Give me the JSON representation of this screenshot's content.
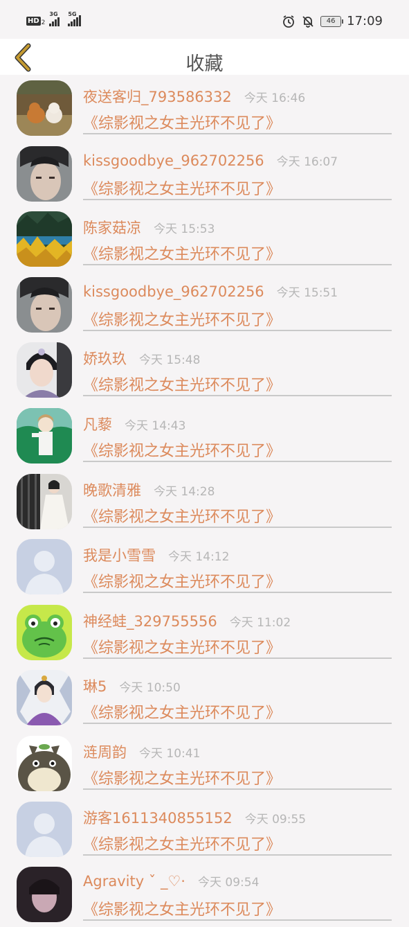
{
  "status_bar": {
    "hd": "HD",
    "sim2": "2",
    "net1": "3G",
    "net2": "5G",
    "battery": "46",
    "time": "17:09"
  },
  "header": {
    "title": "收藏",
    "back_icon": "chevron-left-icon"
  },
  "colors": {
    "accent": "#dc8a5c",
    "time": "#b6b6b6",
    "back": "#c59b32"
  },
  "items": [
    {
      "name": "夜送客归_793586332",
      "time": "今天 16:46",
      "book": "《综影视之女主光环不见了》",
      "avatar": "dogs"
    },
    {
      "name": "kissgoodbye_962702256",
      "time": "今天 16:07",
      "book": "《综影视之女主光环不见了》",
      "avatar": "man-portrait"
    },
    {
      "name": "陈家菇凉",
      "time": "今天 15:53",
      "book": "《综影视之女主光环不见了》",
      "avatar": "autumn-lake"
    },
    {
      "name": "kissgoodbye_962702256",
      "time": "今天 15:51",
      "book": "《综影视之女主光环不见了》",
      "avatar": "man-portrait"
    },
    {
      "name": "娇玖玖",
      "time": "今天 15:48",
      "book": "《综影视之女主光环不见了》",
      "avatar": "costume-woman"
    },
    {
      "name": "凡藜",
      "time": "今天 14:43",
      "book": "《综影视之女主光环不见了》",
      "avatar": "anime-boy"
    },
    {
      "name": "晚歌清雅",
      "time": "今天 14:28",
      "book": "《综影视之女主光环不见了》",
      "avatar": "white-dress"
    },
    {
      "name": "我是小雪雪",
      "time": "今天 14:12",
      "book": "《综影视之女主光环不见了》",
      "avatar": "default-user"
    },
    {
      "name": "神经蛙_329755556",
      "time": "今天 11:02",
      "book": "《综影视之女主光环不见了》",
      "avatar": "frog"
    },
    {
      "name": "琳5",
      "time": "今天 10:50",
      "book": "《综影视之女主光环不见了》",
      "avatar": "drawn-woman"
    },
    {
      "name": "涟周韵",
      "time": "今天 10:41",
      "book": "《综影视之女主光环不见了》",
      "avatar": "totoro"
    },
    {
      "name": "游客1611340855152",
      "time": "今天 09:55",
      "book": "《综影视之女主光环不见了》",
      "avatar": "default-user"
    },
    {
      "name": "Agravity ˇ _♡·",
      "time": "今天 09:54",
      "book": "《综影视之女主光环不见了》",
      "avatar": "dark-portrait"
    }
  ]
}
